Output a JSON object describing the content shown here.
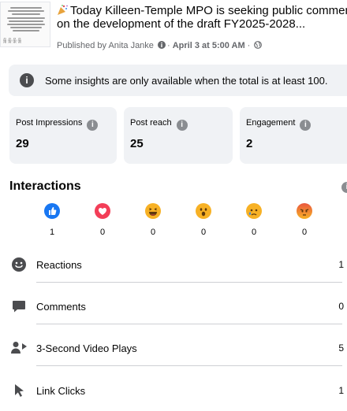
{
  "post": {
    "title_line1": "Today Killeen-Temple MPO is seeking public comment",
    "title_line2": "on the development of the draft FY2025-2028...",
    "published_prefix": "Published by ",
    "author": "Anita Janke",
    "date": "April 3 at 5:00 AM"
  },
  "banner": {
    "text": "Some insights are only available when the total is at least 100."
  },
  "stats": [
    {
      "label": "Post Impressions",
      "value": "29"
    },
    {
      "label": "Post reach",
      "value": "25"
    },
    {
      "label": "Engagement",
      "value": "2"
    }
  ],
  "interactions": {
    "title": "Interactions",
    "reactions": [
      {
        "icon": "like-icon",
        "count": "1",
        "color": "#1877f2"
      },
      {
        "icon": "love-icon",
        "count": "0",
        "color": "#f33e58"
      },
      {
        "icon": "haha-icon",
        "count": "0",
        "color": "#f7b125"
      },
      {
        "icon": "wow-icon",
        "count": "0",
        "color": "#f7b125"
      },
      {
        "icon": "sad-icon",
        "count": "0",
        "color": "#f7b125"
      },
      {
        "icon": "angry-icon",
        "count": "0",
        "color": "#e9710f"
      }
    ],
    "rows": [
      {
        "icon": "smiley-icon",
        "label": "Reactions",
        "value": "1"
      },
      {
        "icon": "comment-icon",
        "label": "Comments",
        "value": "0"
      },
      {
        "icon": "video-play-icon",
        "label": "3-Second Video Plays",
        "value": "5"
      },
      {
        "icon": "cursor-icon",
        "label": "Link Clicks",
        "value": "1"
      }
    ]
  },
  "colors": {
    "card_bg": "#f0f2f5",
    "text": "#050505",
    "muted": "#65676b"
  }
}
